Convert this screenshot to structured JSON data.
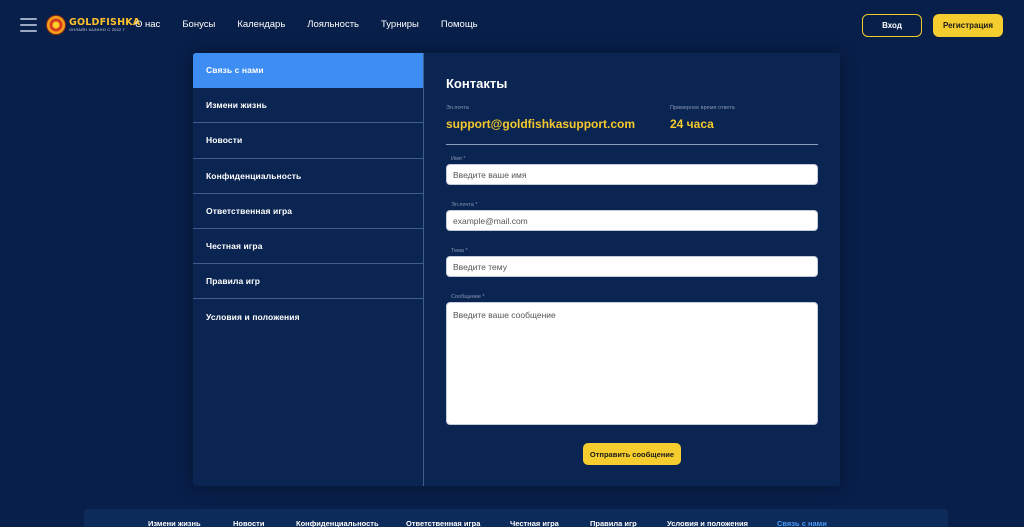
{
  "header": {
    "logo": {
      "name": "GOLDFISHKA",
      "tagline": "ОНЛАЙН КАЗИНО С 2002 Г"
    },
    "nav": [
      "О нас",
      "Бонусы",
      "Календарь",
      "Лояльность",
      "Турниры",
      "Помощь"
    ],
    "login_label": "Вход",
    "register_label": "Регистрация"
  },
  "sidebar": {
    "items": [
      {
        "label": "Связь с нами",
        "active": true
      },
      {
        "label": "Измени жизнь"
      },
      {
        "label": "Новости"
      },
      {
        "label": "Конфиденциальность"
      },
      {
        "label": "Ответственная игра"
      },
      {
        "label": "Честная игра"
      },
      {
        "label": "Правила игр"
      },
      {
        "label": "Условия и положения"
      }
    ]
  },
  "contacts": {
    "title": "Контакты",
    "email_label": "Эл.почта",
    "email_value": "support@goldfishkasupport.com",
    "response_label": "Примерное время ответа",
    "response_value": "24 часа"
  },
  "form": {
    "name_label": "Имя *",
    "name_placeholder": "Введите ваше имя",
    "email_label": "Эл.почта *",
    "email_placeholder": "example@mail.com",
    "subject_label": "Тема *",
    "subject_placeholder": "Введите тему",
    "message_label": "Сообщение *",
    "message_placeholder": "Введите ваше сообщение",
    "submit_label": "Отправить сообщение"
  },
  "footer": {
    "links": [
      "Измени жизнь",
      "Новости",
      "Конфиденциальность",
      "Ответственная игра",
      "Честная игра",
      "Правила игр",
      "Условия и положения",
      "Связь с нами"
    ],
    "active_index": 7
  },
  "colors": {
    "background": "#081f4a",
    "card": "#0b2552",
    "accent_yellow": "#f5cd2e",
    "active_blue": "#3d8df3"
  }
}
